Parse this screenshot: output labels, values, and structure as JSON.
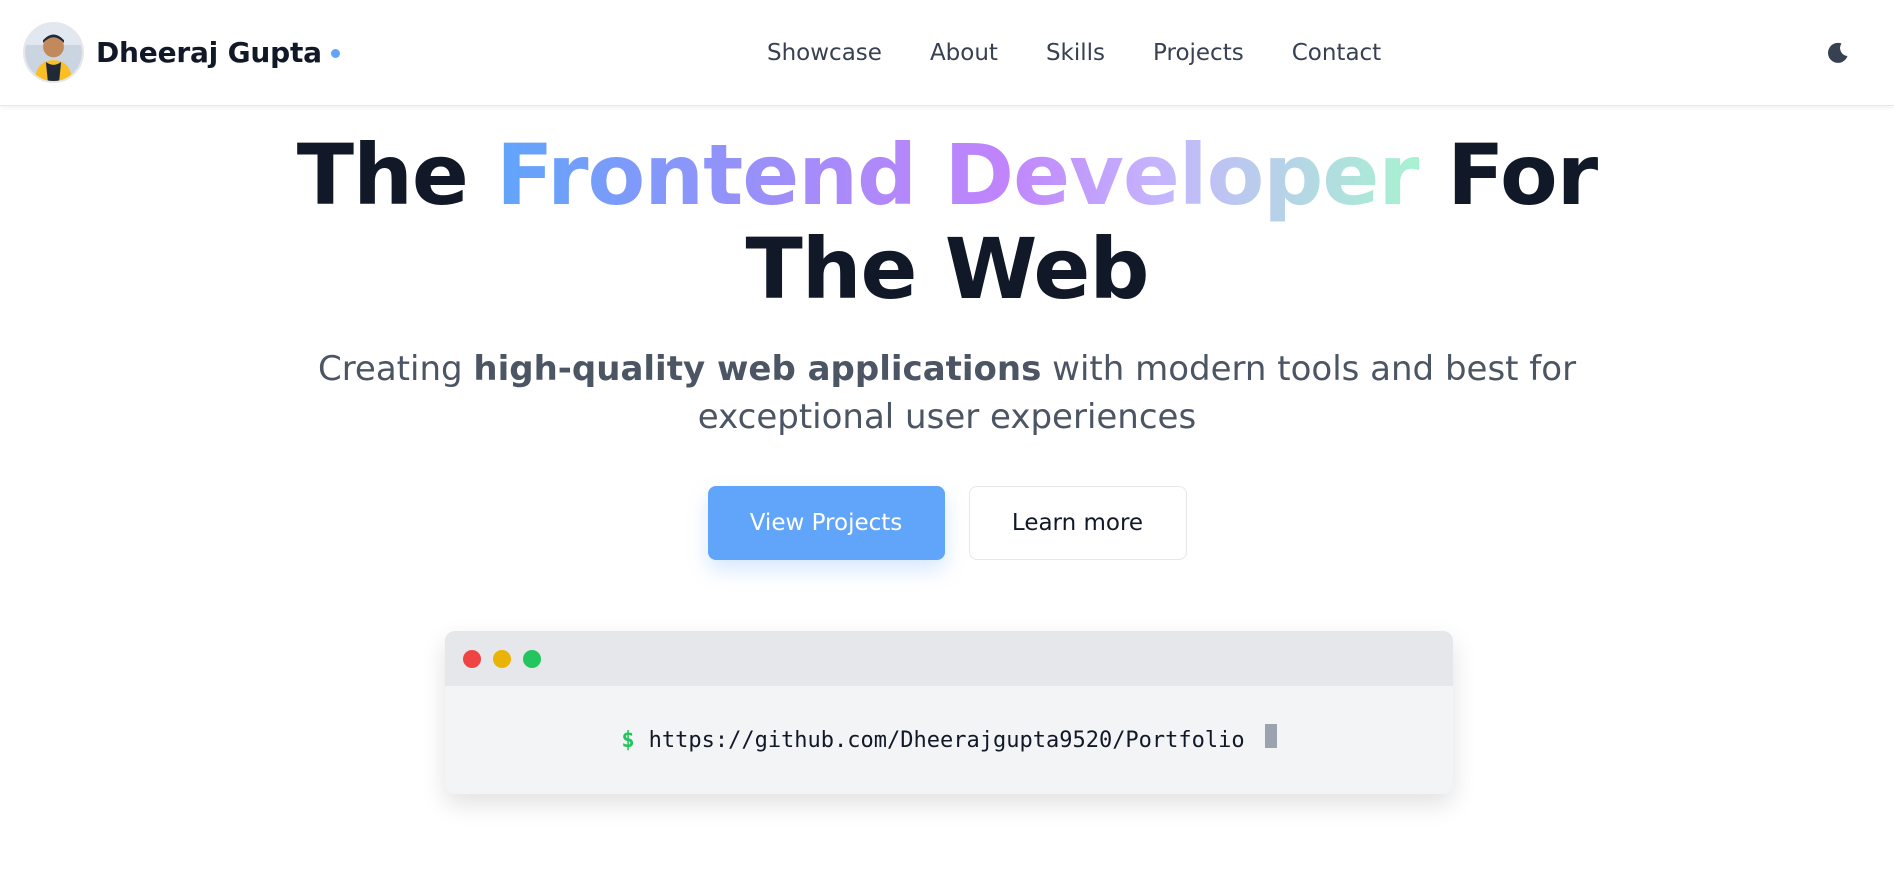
{
  "header": {
    "brand_name": "Dheeraj Gupta",
    "nav": [
      {
        "label": "Showcase"
      },
      {
        "label": "About"
      },
      {
        "label": "Skills"
      },
      {
        "label": "Projects"
      },
      {
        "label": "Contact"
      }
    ],
    "theme_icon": "moon-icon"
  },
  "hero": {
    "title_prefix": "The ",
    "title_highlight": "Frontend Developer",
    "title_suffix": " For",
    "title_line2": "The Web",
    "subtitle_part1": "Creating ",
    "subtitle_bold": "high-quality web applications",
    "subtitle_part2": " with modern tools and best for exceptional user experiences",
    "primary_cta": "View Projects",
    "secondary_cta": "Learn more"
  },
  "terminal": {
    "prompt": "$",
    "command": "https://github.com/Dheerajgupta9520/Portfolio"
  },
  "colors": {
    "accent": "#60a5fa",
    "text_dark": "#111827",
    "text_muted": "#4b5563",
    "terminal_bg": "#f3f4f6",
    "terminal_bar": "#e5e7eb",
    "prompt_green": "#22c55e",
    "dot_red": "#ef4444",
    "dot_yellow": "#eab308",
    "dot_green": "#22c55e"
  }
}
